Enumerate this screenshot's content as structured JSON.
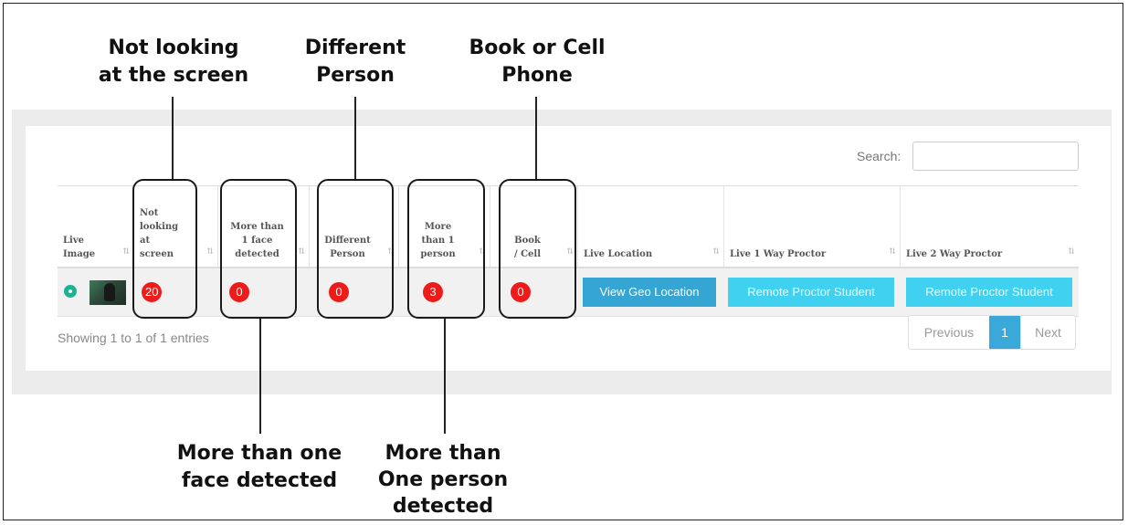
{
  "callouts": {
    "not_looking": [
      "Not looking",
      "at the screen"
    ],
    "different_person": [
      "Different",
      "Person"
    ],
    "book_cell": [
      "Book or Cell",
      "Phone"
    ],
    "more_face": [
      "More than one",
      "face detected"
    ],
    "more_person": [
      "More than",
      "One person",
      "detected"
    ]
  },
  "search": {
    "label": "Search:",
    "value": ""
  },
  "table": {
    "headers": {
      "live_image": [
        "Live",
        "Image"
      ],
      "not_looking": [
        "Not",
        "looking",
        "at",
        "screen"
      ],
      "more_face": [
        "More than",
        "1 face",
        "detected"
      ],
      "different_person": [
        "Different",
        "Person"
      ],
      "more_person": [
        "More",
        "than 1",
        "person"
      ],
      "book_cell": [
        "Book",
        "/ Cell"
      ],
      "live_location": "Live Location",
      "live_1way": "Live 1 Way Proctor",
      "live_2way": "Live 2 Way Proctor"
    },
    "row": {
      "not_looking": "20",
      "more_face": "0",
      "different_person": "0",
      "more_person": "3",
      "book_cell": "0",
      "geo_button": "View Geo Location",
      "proctor1_button": "Remote Proctor Student",
      "proctor2_button": "Remote Proctor Student"
    }
  },
  "footer": {
    "info": "Showing 1 to 1 of 1 entries"
  },
  "pagination": {
    "previous": "Previous",
    "page": "1",
    "next": "Next"
  },
  "colors": {
    "badge": "#ee1b1b",
    "geo_button": "#35a5d3",
    "proctor_button": "#3fd1ef",
    "active_page": "#3aa8d8",
    "status_dot": "#1ab394"
  },
  "icons": {
    "row_expand": "plus-circle-icon",
    "sort": "sort-arrows-icon",
    "thumbnail": "webcam-thumbnail"
  }
}
